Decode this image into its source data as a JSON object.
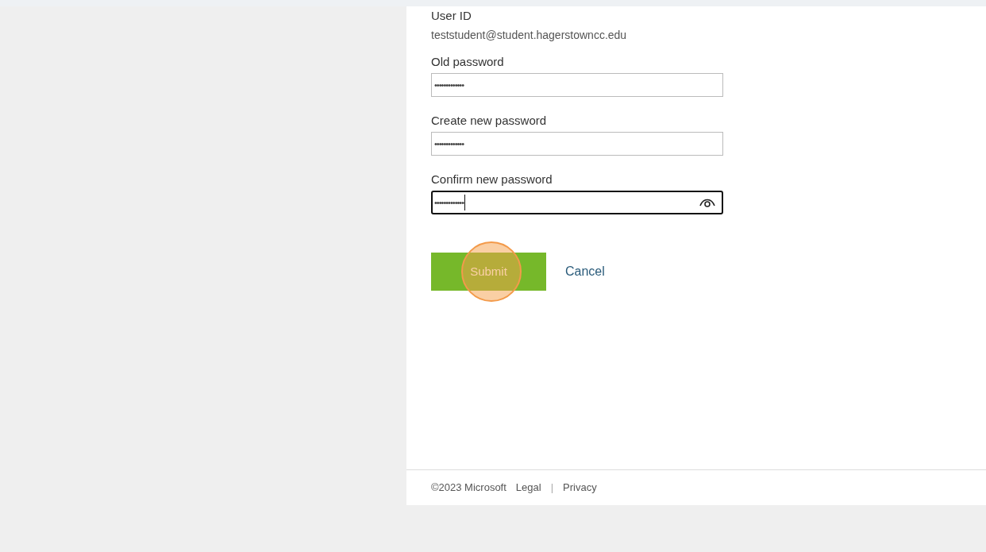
{
  "user_id": {
    "label": "User ID",
    "value": "teststudent@student.hagerstowncc.edu"
  },
  "fields": [
    {
      "label": "Old password",
      "value": "•••••••••••••",
      "focused": false,
      "reveal_icon": false
    },
    {
      "label": "Create new password",
      "value": "•••••••••••••",
      "focused": false,
      "reveal_icon": false
    },
    {
      "label": "Confirm new password",
      "value": "•••••••••••••",
      "focused": true,
      "reveal_icon": true
    }
  ],
  "buttons": [
    {
      "kind": "primary",
      "label": "Submit",
      "click_highlight": true
    },
    {
      "kind": "link",
      "label": "Cancel",
      "click_highlight": false
    }
  ],
  "footer": {
    "copyright": "©2023 Microsoft",
    "links": [
      "Legal",
      "Privacy"
    ],
    "separator": "|"
  }
}
